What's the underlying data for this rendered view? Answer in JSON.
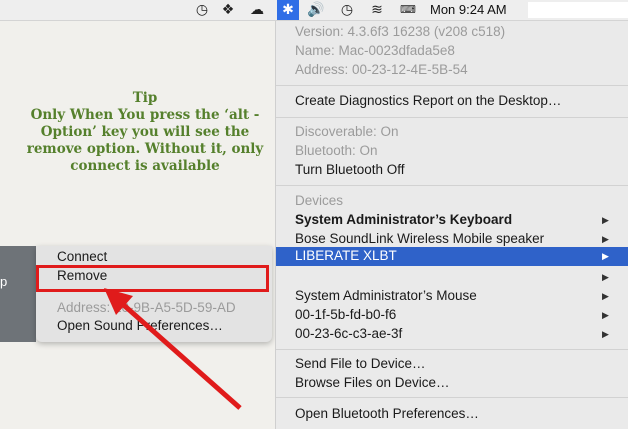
{
  "menubar": {
    "clock": "Mon 9:24 AM",
    "icons": [
      "time-machine-icon",
      "dropbox-icon",
      "cloud-icon",
      "bluetooth-icon",
      "volume-icon",
      "history-icon",
      "wifi-icon",
      "keyboard-input-icon"
    ]
  },
  "tip": {
    "title": "Tip",
    "body": "Only When You press the ‘alt - Option’ key you will see the remove option. Without it, only connect is available"
  },
  "left_strip": {
    "label": "p"
  },
  "submenu": {
    "connect": "Connect",
    "remove": "Remove",
    "address": "Address: 20-9B-A5-5D-59-AD",
    "open_sound": "Open Sound Preferences…"
  },
  "bluetooth_menu": {
    "version": "Version: 4.3.6f3 16238 (v208 c518)",
    "name": "Name: Mac-0023dfada5e8",
    "address": "Address: 00-23-12-4E-5B-54",
    "create_report": "Create Diagnostics Report on the Desktop…",
    "discoverable": "Discoverable: On",
    "bluetooth_on": "Bluetooth: On",
    "turn_off": "Turn Bluetooth Off",
    "devices_header": "Devices",
    "devices": [
      "System Administrator’s Keyboard",
      "Bose SoundLink Wireless Mobile speaker",
      "LIBERATE XLBT",
      "System Administrator’s Mouse",
      "00-1f-5b-fd-b0-f6",
      "00-23-6c-c3-ae-3f"
    ],
    "send_file": "Send File to Device…",
    "browse_files": "Browse Files on Device…",
    "open_prefs": "Open Bluetooth Preferences…"
  },
  "colors": {
    "highlight": "#2f62c9",
    "annotation_red": "#e01b1b",
    "tip_green": "#55802c"
  }
}
